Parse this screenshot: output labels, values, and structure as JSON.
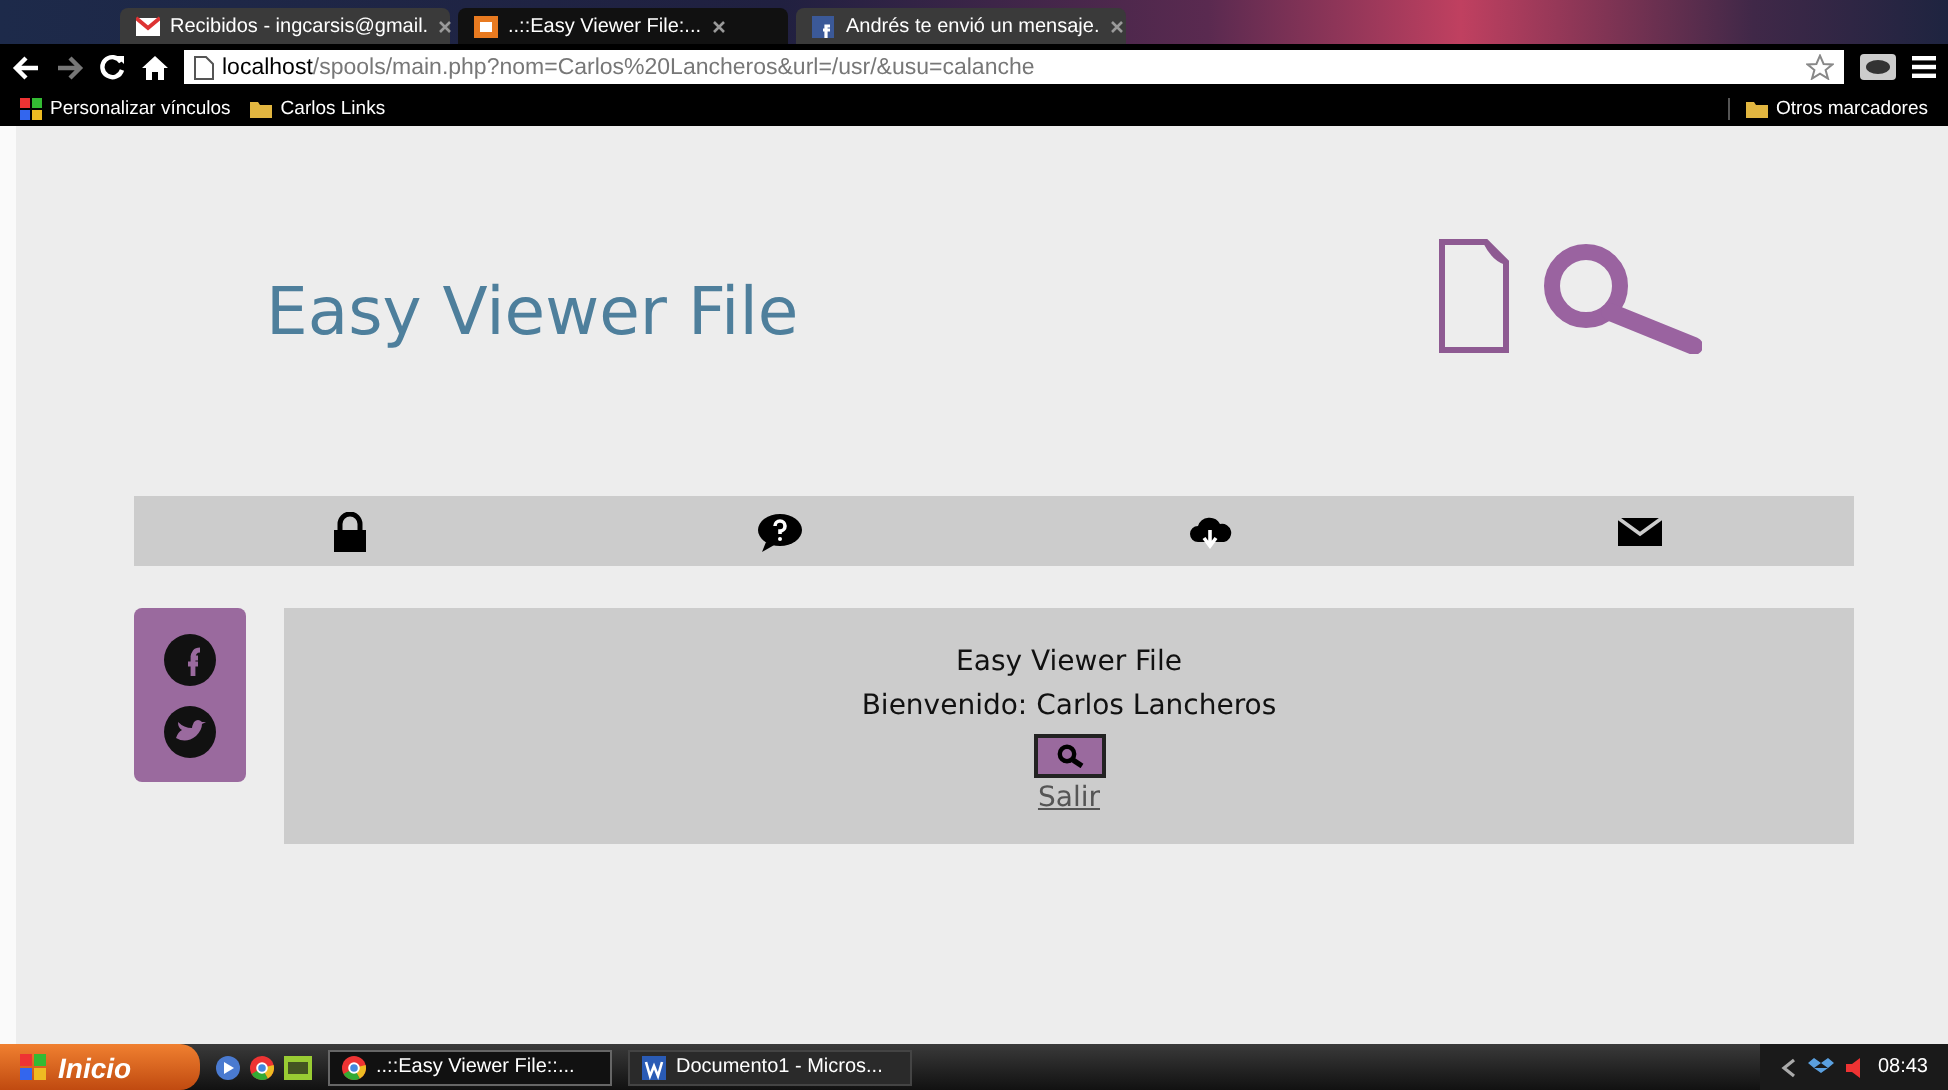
{
  "browser": {
    "tabs": [
      {
        "label": "Recibidos - ingcarsis@gmail.",
        "selected": false,
        "kind": "mail"
      },
      {
        "label": "..::Easy Viewer File:...",
        "selected": true,
        "kind": "app"
      },
      {
        "label": "Andrés te envió un mensaje.",
        "selected": false,
        "kind": "facebook"
      }
    ],
    "address": {
      "host": "localhost",
      "path": "/spools/main.php?nom=Carlos%20Lancheros&url=/usr/&usu=calanche"
    },
    "bookmarks": [
      {
        "label": "Personalizar vínculos",
        "kind": "windows"
      },
      {
        "label": "Carlos Links",
        "kind": "folder"
      }
    ],
    "other_bookmarks": "Otros marcadores"
  },
  "page": {
    "title": "Easy Viewer File",
    "nav": [
      {
        "kind": "lock"
      },
      {
        "kind": "help"
      },
      {
        "kind": "cloud"
      },
      {
        "kind": "mail"
      }
    ],
    "social": [
      {
        "kind": "facebook"
      },
      {
        "kind": "twitter"
      }
    ],
    "content": {
      "title": "Easy Viewer File",
      "welcome": "Bienvenido: Carlos Lancheros",
      "logout": "Salir"
    }
  },
  "taskbar": {
    "start": "Inicio",
    "tasks": [
      {
        "label": "..::Easy Viewer File::...",
        "selected": true,
        "kind": "chrome"
      },
      {
        "label": "Documento1 - Micros...",
        "selected": false,
        "kind": "word"
      }
    ],
    "clock": "08:43"
  }
}
